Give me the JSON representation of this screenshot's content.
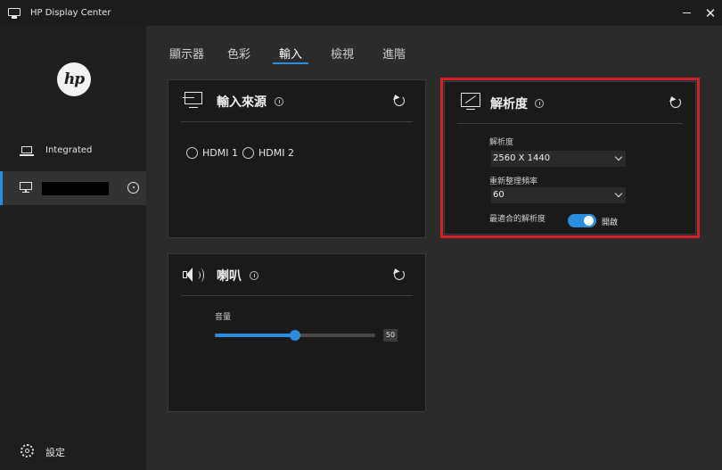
{
  "window": {
    "title": "HP Display Center",
    "close_label": "✕"
  },
  "sidebar": {
    "logo_text": "hp",
    "items": [
      {
        "label": "Integrated",
        "icon": "laptop-icon"
      },
      {
        "label": "",
        "icon": "monitor-icon",
        "selected": true,
        "redacted": true
      }
    ],
    "settings_label": "設定"
  },
  "tabs": [
    {
      "label": "顯示器"
    },
    {
      "label": "色彩"
    },
    {
      "label": "輸入",
      "active": true
    },
    {
      "label": "檢視"
    },
    {
      "label": "進階"
    }
  ],
  "input_source": {
    "title": "輸入來源",
    "options": [
      "HDMI 1",
      "HDMI 2"
    ]
  },
  "speaker": {
    "title": "喇叭",
    "volume_label": "音量",
    "volume": 50,
    "volume_max": 100,
    "volume_text": "50"
  },
  "resolution": {
    "title": "解析度",
    "resolution_label": "解析度",
    "resolution_value": "2560 X 1440",
    "refresh_label": "重新整理頻率",
    "refresh_value": "60",
    "best_fit_label": "最適合的解析度",
    "best_fit_on": true,
    "best_fit_state": "開啟"
  },
  "colors": {
    "accent": "#2a8ee0",
    "highlight_box": "#d61f26",
    "card_bg": "#1a1a1a",
    "sidebar_bg": "#1e1e1e"
  }
}
